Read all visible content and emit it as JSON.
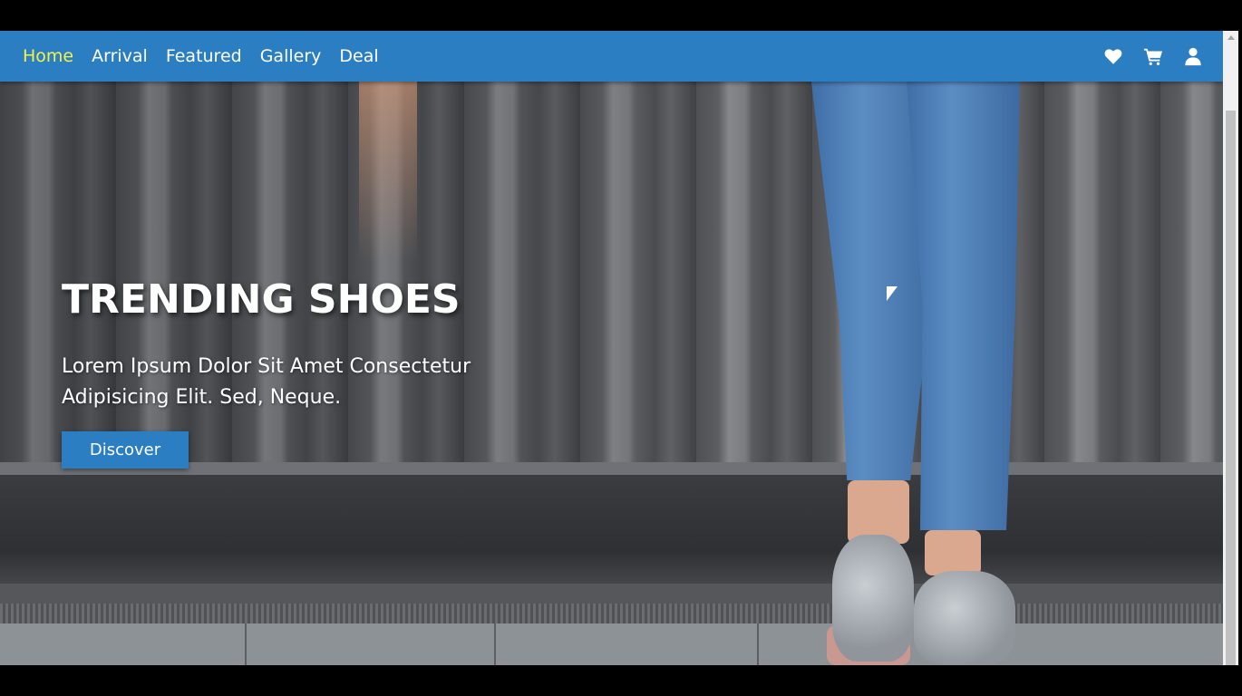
{
  "nav": {
    "links": [
      {
        "label": "Home",
        "active": true
      },
      {
        "label": "Arrival",
        "active": false
      },
      {
        "label": "Featured",
        "active": false
      },
      {
        "label": "Gallery",
        "active": false
      },
      {
        "label": "Deal",
        "active": false
      }
    ],
    "icons": [
      "heart-icon",
      "shopping-cart-icon",
      "user-icon"
    ],
    "active_color": "#f2f24a"
  },
  "hero": {
    "title": "TRENDING SHOES",
    "subtitle_line1": "Lorem Ipsum Dolor Sit Amet Consectetur",
    "subtitle_line2": "Adipisicing Elit. Sed, Neque.",
    "button_label": "Discover"
  },
  "colors": {
    "primary": "#2b7ec1",
    "navbar_text": "#ffffff"
  }
}
